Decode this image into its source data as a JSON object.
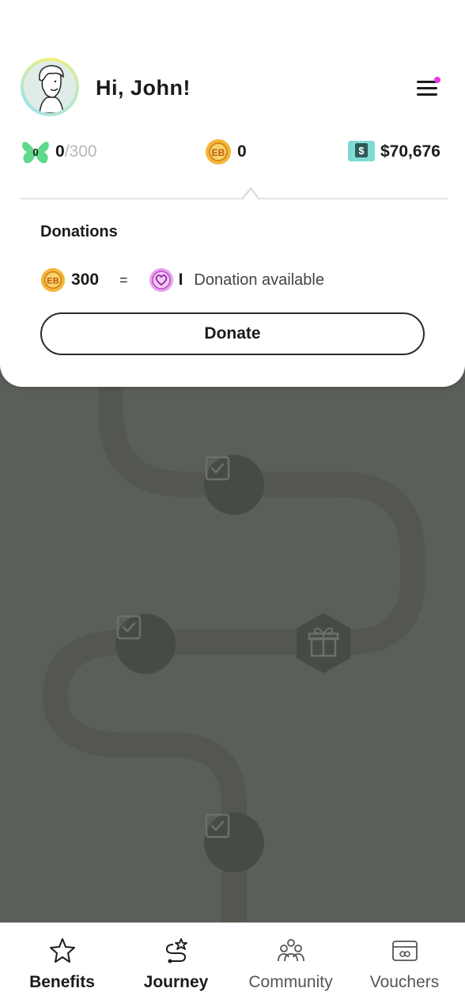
{
  "header": {
    "greeting": "Hi, John!"
  },
  "stats": {
    "butterfly_value": "0",
    "butterfly_badge": "0",
    "butterfly_total": "/300",
    "coins": "0",
    "cash": "$70,676"
  },
  "donations": {
    "title": "Donations",
    "coin_amount": "300",
    "equals": "=",
    "donation_count": "I",
    "available_text": "Donation available",
    "donate_label": "Donate"
  },
  "nav": {
    "items": [
      {
        "label": "Benefits",
        "icon": "star-icon"
      },
      {
        "label": "Journey",
        "icon": "journey-icon"
      },
      {
        "label": "Community",
        "icon": "community-icon"
      },
      {
        "label": "Vouchers",
        "icon": "voucher-icon"
      }
    ]
  },
  "colors": {
    "background": "#5b5f59",
    "path": "#53574f",
    "node": "#474b45",
    "notification_dot": "#e83ad8",
    "butterfly": "#5fd98a",
    "coin": "#f4b63a",
    "cash": "#7fdad4",
    "heart": "#e9a1ee"
  }
}
